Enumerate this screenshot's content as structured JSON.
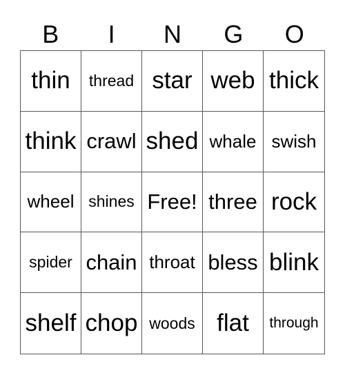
{
  "header": {
    "letters": [
      "B",
      "I",
      "N",
      "G",
      "O"
    ]
  },
  "card": {
    "rows": [
      [
        "thin",
        "thread",
        "star",
        "web",
        "thick"
      ],
      [
        "think",
        "crawl",
        "shed",
        "whale",
        "swish"
      ],
      [
        "wheel",
        "shines",
        "Free!",
        "three",
        "rock"
      ],
      [
        "spider",
        "chain",
        "throat",
        "bless",
        "blink"
      ],
      [
        "shelf",
        "chop",
        "woods",
        "flat",
        "through"
      ]
    ]
  }
}
